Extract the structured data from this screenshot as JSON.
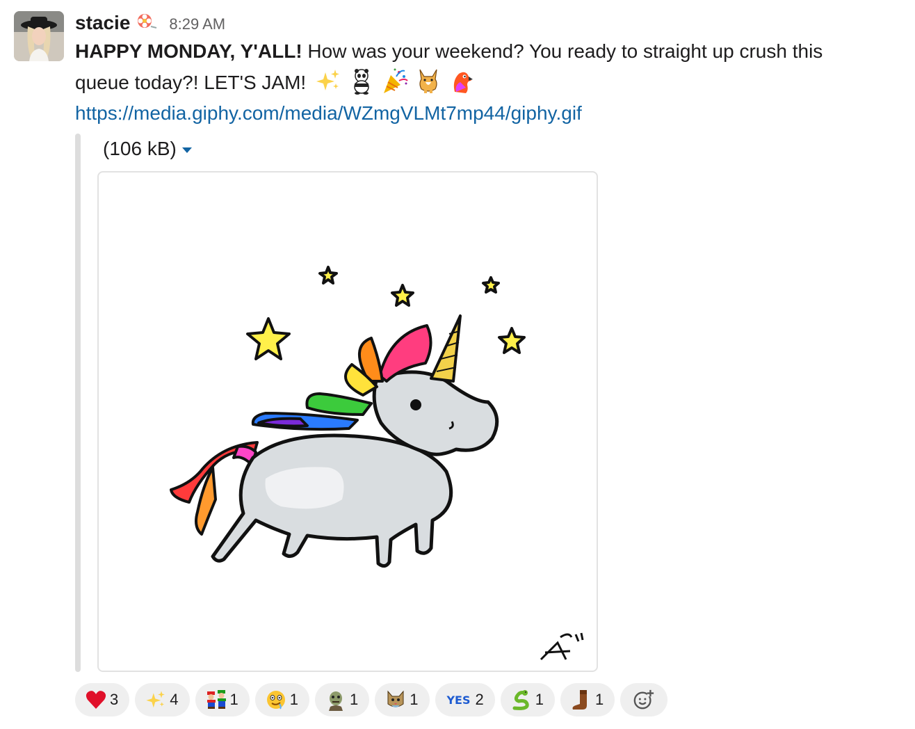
{
  "message": {
    "username": "stacie",
    "timestamp": "8:29 AM",
    "text_bold": "HAPPY MONDAY, Y'ALL!",
    "text_line1": " How was your weekend? You ready to straight up crush this",
    "text_line2": "queue today?! LET'S JAM!",
    "inline_emojis": [
      "sparkles-icon",
      "panda-dance-icon",
      "party-popper-icon",
      "corgi-icon",
      "party-parrot-icon"
    ],
    "link": "https://media.giphy.com/media/WZmgVLMt7mp44/giphy.gif"
  },
  "attachment": {
    "file_size": "(106 kB)",
    "image": "rainbow unicorn gif"
  },
  "reactions": [
    {
      "icon": "heart-icon",
      "count": "3"
    },
    {
      "icon": "sparkles-icon",
      "count": "4"
    },
    {
      "icon": "mario-luigi-icon",
      "count": "1"
    },
    {
      "icon": "drooling-face-icon",
      "count": "1"
    },
    {
      "icon": "zombie-icon",
      "count": "1"
    },
    {
      "icon": "cat-icon",
      "count": "1"
    },
    {
      "icon": "yes-icon",
      "label": "YES",
      "count": "2"
    },
    {
      "icon": "snake-icon",
      "count": "1"
    },
    {
      "icon": "cowboy-boot-icon",
      "count": "1"
    }
  ],
  "colors": {
    "link": "#1264a3",
    "reaction_bg": "#efefef",
    "text": "#1d1c1d",
    "muted": "#616061"
  }
}
